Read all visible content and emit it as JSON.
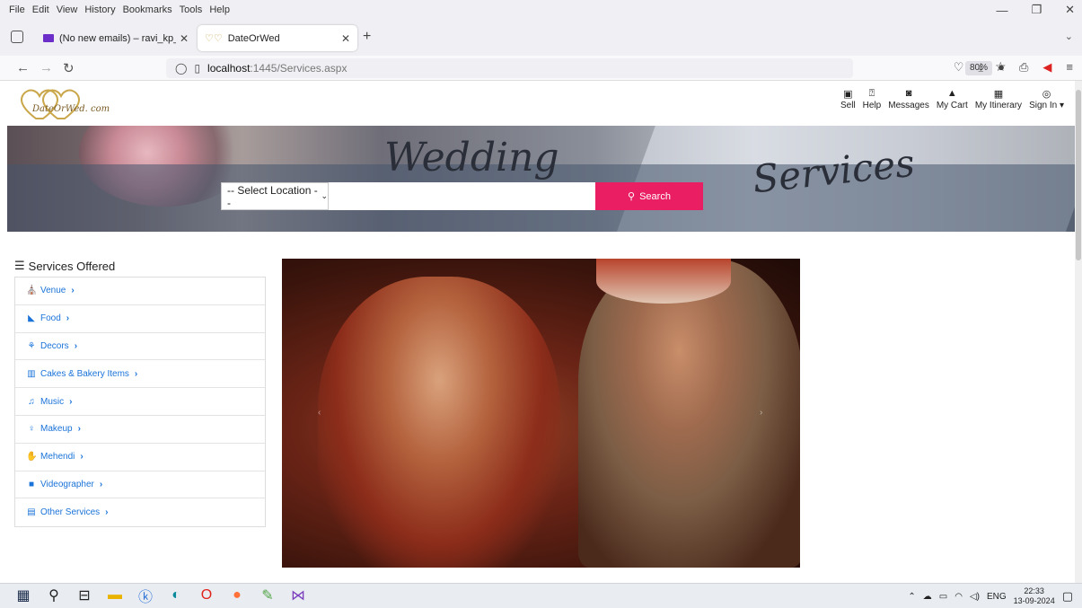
{
  "browser": {
    "menu": [
      "File",
      "Edit",
      "View",
      "History",
      "Bookmarks",
      "Tools",
      "Help"
    ],
    "tabs": [
      {
        "title": "(No new emails) – ravi_kp_com"
      },
      {
        "title": "DateOrWed"
      }
    ],
    "url": {
      "host": "localhost",
      "path": ":1445/Services.aspx"
    },
    "zoom": "80%"
  },
  "header": {
    "logo_text": "DateOrWed. com",
    "links": [
      {
        "label": "Sell",
        "icon": "store-icon"
      },
      {
        "label": "Help",
        "icon": "help-icon"
      },
      {
        "label": "Messages",
        "icon": "messages-icon"
      },
      {
        "label": "My Cart",
        "icon": "cart-icon"
      },
      {
        "label": "My Itinerary",
        "icon": "calendar-icon"
      },
      {
        "label": "Sign In ▾",
        "icon": "user-icon"
      }
    ]
  },
  "banner": {
    "word1": "Wedding",
    "word2": "Services",
    "location_select": "-- Select Location --",
    "search_placeholder": "",
    "search_label": "Search"
  },
  "sidebar": {
    "title": "Services Offered",
    "items": [
      {
        "label": "Venue",
        "icon": "venue-icon"
      },
      {
        "label": "Food",
        "icon": "food-icon"
      },
      {
        "label": "Decors",
        "icon": "decors-icon"
      },
      {
        "label": "Cakes & Bakery Items",
        "icon": "cake-icon"
      },
      {
        "label": "Music",
        "icon": "music-icon"
      },
      {
        "label": "Makeup",
        "icon": "makeup-icon"
      },
      {
        "label": "Mehendi",
        "icon": "mehendi-icon"
      },
      {
        "label": "Videographer",
        "icon": "video-icon"
      },
      {
        "label": "Other Services",
        "icon": "other-services-icon"
      }
    ]
  },
  "taskbar": {
    "lang": "ENG",
    "time": "22:33",
    "date": "13-09-2024"
  }
}
